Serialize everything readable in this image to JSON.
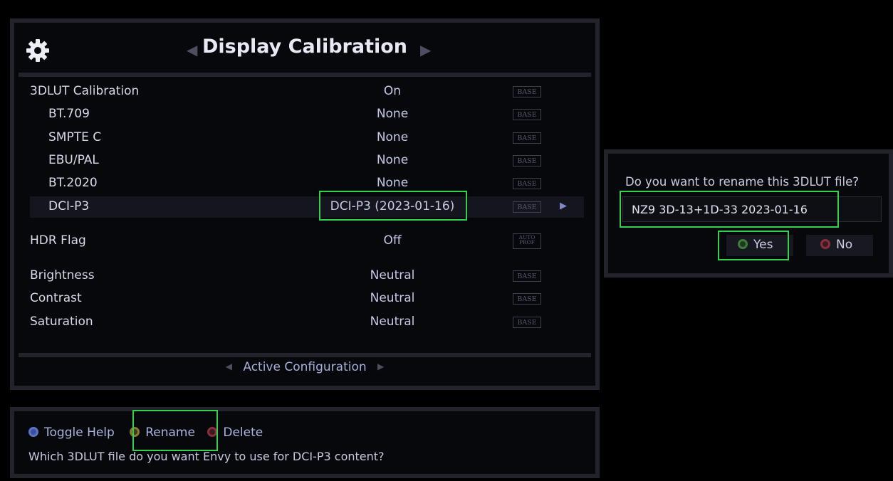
{
  "header": {
    "title": "Display Calibration"
  },
  "menu": [
    {
      "label": "3DLUT Calibration",
      "value": "On",
      "badge": "BASE"
    },
    {
      "label": "BT.709",
      "value": "None",
      "badge": "BASE"
    },
    {
      "label": "SMPTE C",
      "value": "None",
      "badge": "BASE"
    },
    {
      "label": "EBU/PAL",
      "value": "None",
      "badge": "BASE"
    },
    {
      "label": "BT.2020",
      "value": "None",
      "badge": "BASE"
    },
    {
      "label": "DCI-P3",
      "value": "DCI-P3 (2023-01-16)",
      "badge": "BASE"
    },
    {
      "label": "HDR Flag",
      "value": "Off",
      "badge_line1": "AUTO",
      "badge_line2": "PROF"
    },
    {
      "label": "Brightness",
      "value": "Neutral",
      "badge": "BASE"
    },
    {
      "label": "Contrast",
      "value": "Neutral",
      "badge": "BASE"
    },
    {
      "label": "Saturation",
      "value": "Neutral",
      "badge": "BASE"
    }
  ],
  "footer": {
    "active_configuration": "Active Configuration"
  },
  "help": {
    "toggle_help": "Toggle Help",
    "rename": "Rename",
    "delete": "Delete",
    "description": "Which 3DLUT file do you want Envy to use for DCI-P3 content?"
  },
  "dialog": {
    "question": "Do you want to rename this 3DLUT file?",
    "filename": "NZ9 3D-13+1D-33 2023-01-16",
    "yes": "Yes",
    "no": "No"
  },
  "colors": {
    "highlight": "#34d14f",
    "blue_button": "#3b4f9c",
    "green_button": "#3d7a3d",
    "red_button": "#8a2f3a",
    "yellow_button": "#8a7a2a"
  },
  "icons": {
    "settings": "gear-icon",
    "previous": "left-triangle-icon",
    "next": "right-triangle-icon"
  }
}
